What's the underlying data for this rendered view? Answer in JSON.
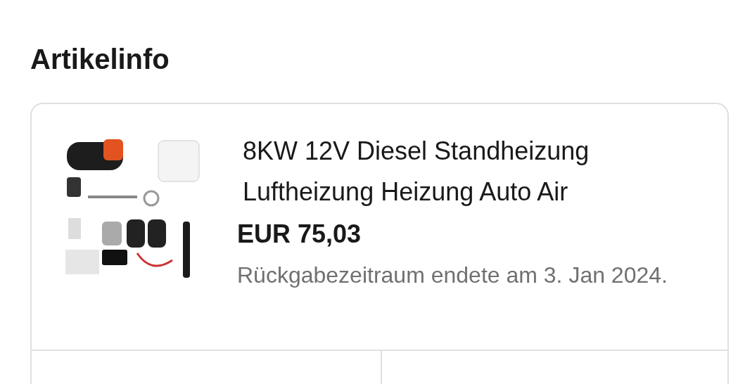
{
  "heading": "Artikelinfo",
  "item": {
    "title": "8KW 12V Diesel Standheizung Luftheizung Heizung Auto Air",
    "price": "EUR 75,03",
    "return_note": "Rückgabezeitraum endete am 3. Jan 2024."
  }
}
